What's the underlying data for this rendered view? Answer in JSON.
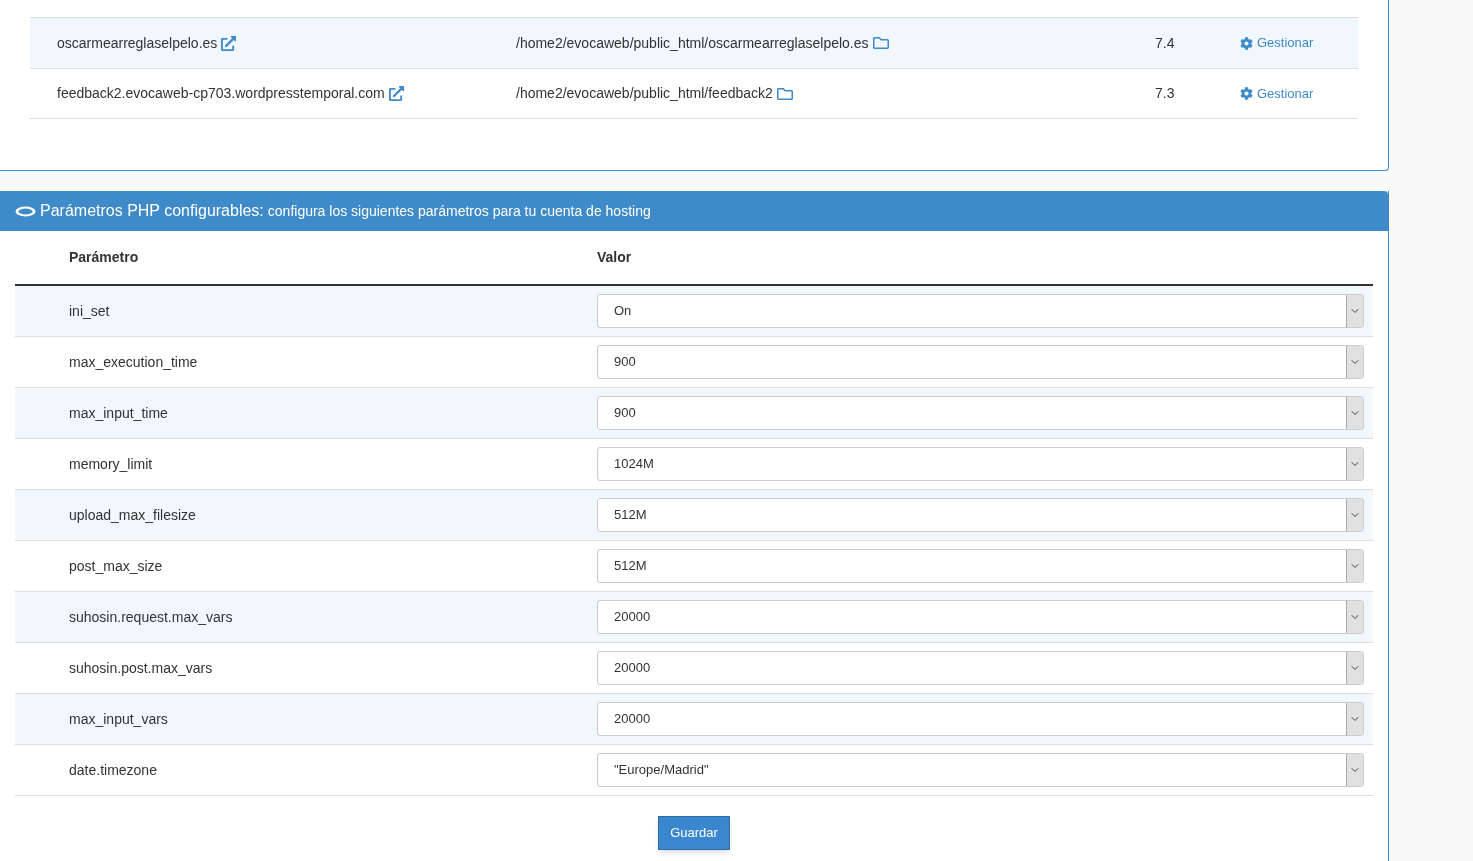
{
  "sites": [
    {
      "domain": "oscarmearreglaselpelo.es",
      "path": "/home2/evocaweb/public_html/oscarmearreglaselpelo.es",
      "version": "7.4",
      "action": "Gestionar"
    },
    {
      "domain": "feedback2.evocaweb-cp703.wordpresstemporal.com",
      "path": "/home2/evocaweb/public_html/feedback2",
      "version": "7.3",
      "action": "Gestionar"
    }
  ],
  "php_panel": {
    "title": "Parámetros PHP configurables:",
    "subtitle": "configura los siguientes parámetros para tu cuenta de hosting",
    "columns": [
      "Parámetro",
      "Valor"
    ],
    "rows": [
      {
        "name": "ini_set",
        "value": "On"
      },
      {
        "name": "max_execution_time",
        "value": "900"
      },
      {
        "name": "max_input_time",
        "value": "900"
      },
      {
        "name": "memory_limit",
        "value": "1024M"
      },
      {
        "name": "upload_max_filesize",
        "value": "512M"
      },
      {
        "name": "post_max_size",
        "value": "512M"
      },
      {
        "name": "suhosin.request.max_vars",
        "value": "20000"
      },
      {
        "name": "suhosin.post.max_vars",
        "value": "20000"
      },
      {
        "name": "max_input_vars",
        "value": "20000"
      },
      {
        "name": "date.timezone",
        "value": "\"Europe/Madrid\""
      }
    ],
    "save_button": "Guardar"
  }
}
